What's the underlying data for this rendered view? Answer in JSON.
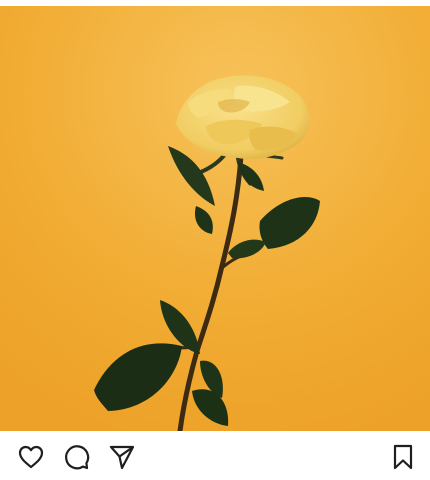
{
  "post": {
    "image": {
      "subject": "yellow-rose",
      "colors": {
        "background": "#f3ad33",
        "background_light": "#f7c05a",
        "petal": "#f3d36b",
        "petal_shadow": "#d9a93a",
        "stem": "#3d2a13",
        "leaf": "#1f3318"
      }
    },
    "actions": {
      "like_icon": "heart-outline",
      "comment_icon": "speech-bubble-outline",
      "share_icon": "paper-plane-outline",
      "save_icon": "bookmark-outline",
      "icon_color": "#1f1f1f"
    }
  }
}
